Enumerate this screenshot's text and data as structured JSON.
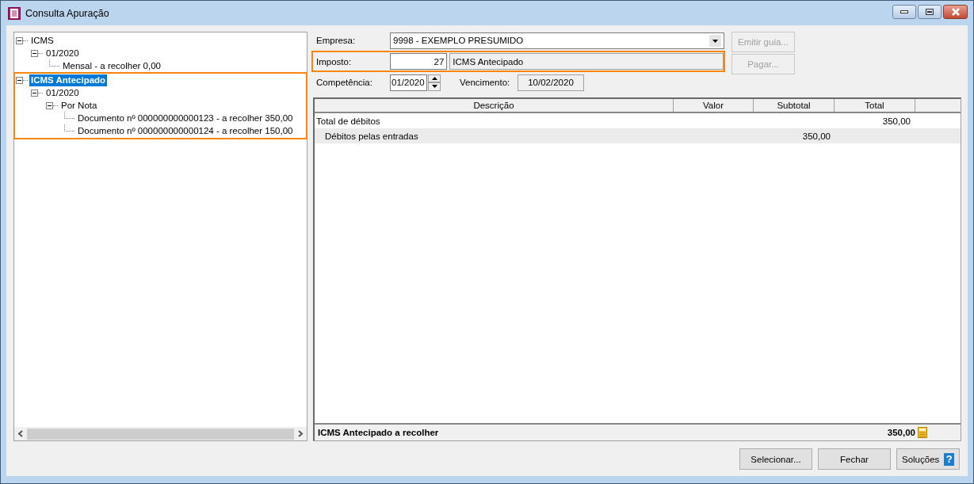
{
  "window": {
    "title": "Consulta Apuração"
  },
  "tree": [
    {
      "label": "ICMS",
      "expanded": true,
      "selected": false,
      "children": [
        {
          "label": "01/2020",
          "expanded": true,
          "selected": false,
          "children": [
            {
              "label": "Mensal - a recolher 0,00",
              "selected": false
            }
          ]
        }
      ]
    },
    {
      "label": "ICMS Antecipado",
      "expanded": true,
      "selected": true,
      "highlighted": true,
      "children": [
        {
          "label": "01/2020",
          "expanded": true,
          "selected": false,
          "children": [
            {
              "label": "Por Nota",
              "expanded": true,
              "selected": false,
              "children": [
                {
                  "label": "Documento nº 000000000000123 - a recolher 350,00",
                  "selected": false
                },
                {
                  "label": "Documento nº 000000000000124 - a recolher 150,00",
                  "selected": false
                }
              ]
            }
          ]
        }
      ]
    }
  ],
  "form": {
    "empresa": {
      "label": "Empresa:",
      "value": "9998 - EXEMPLO PRESUMIDO"
    },
    "imposto": {
      "label": "Imposto:",
      "code": "27",
      "name": "ICMS Antecipado",
      "highlighted": true
    },
    "competencia": {
      "label": "Competência:",
      "value": "01/2020"
    },
    "vencimento": {
      "label": "Vencimento:",
      "value": "10/02/2020"
    }
  },
  "side_buttons": [
    {
      "label": "Emitir guia...",
      "disabled": true
    },
    {
      "label": "Pagar...",
      "disabled": true
    }
  ],
  "table": {
    "columns": [
      "Descrição",
      "Valor",
      "Subtotal",
      "Total"
    ],
    "rows": [
      {
        "kind": "group",
        "cells": [
          "Total de débitos",
          "",
          "",
          "350,00"
        ]
      },
      {
        "kind": "detail",
        "cells": [
          "Débitos pelas entradas",
          "",
          "350,00",
          ""
        ]
      }
    ],
    "footer": {
      "label": "ICMS Antecipado a recolher",
      "value": "350,00"
    }
  },
  "buttons": [
    {
      "label": "Selecionar..."
    },
    {
      "label": "Fechar"
    },
    {
      "label": "Soluções",
      "kind": "help",
      "icon_text": "?"
    }
  ]
}
